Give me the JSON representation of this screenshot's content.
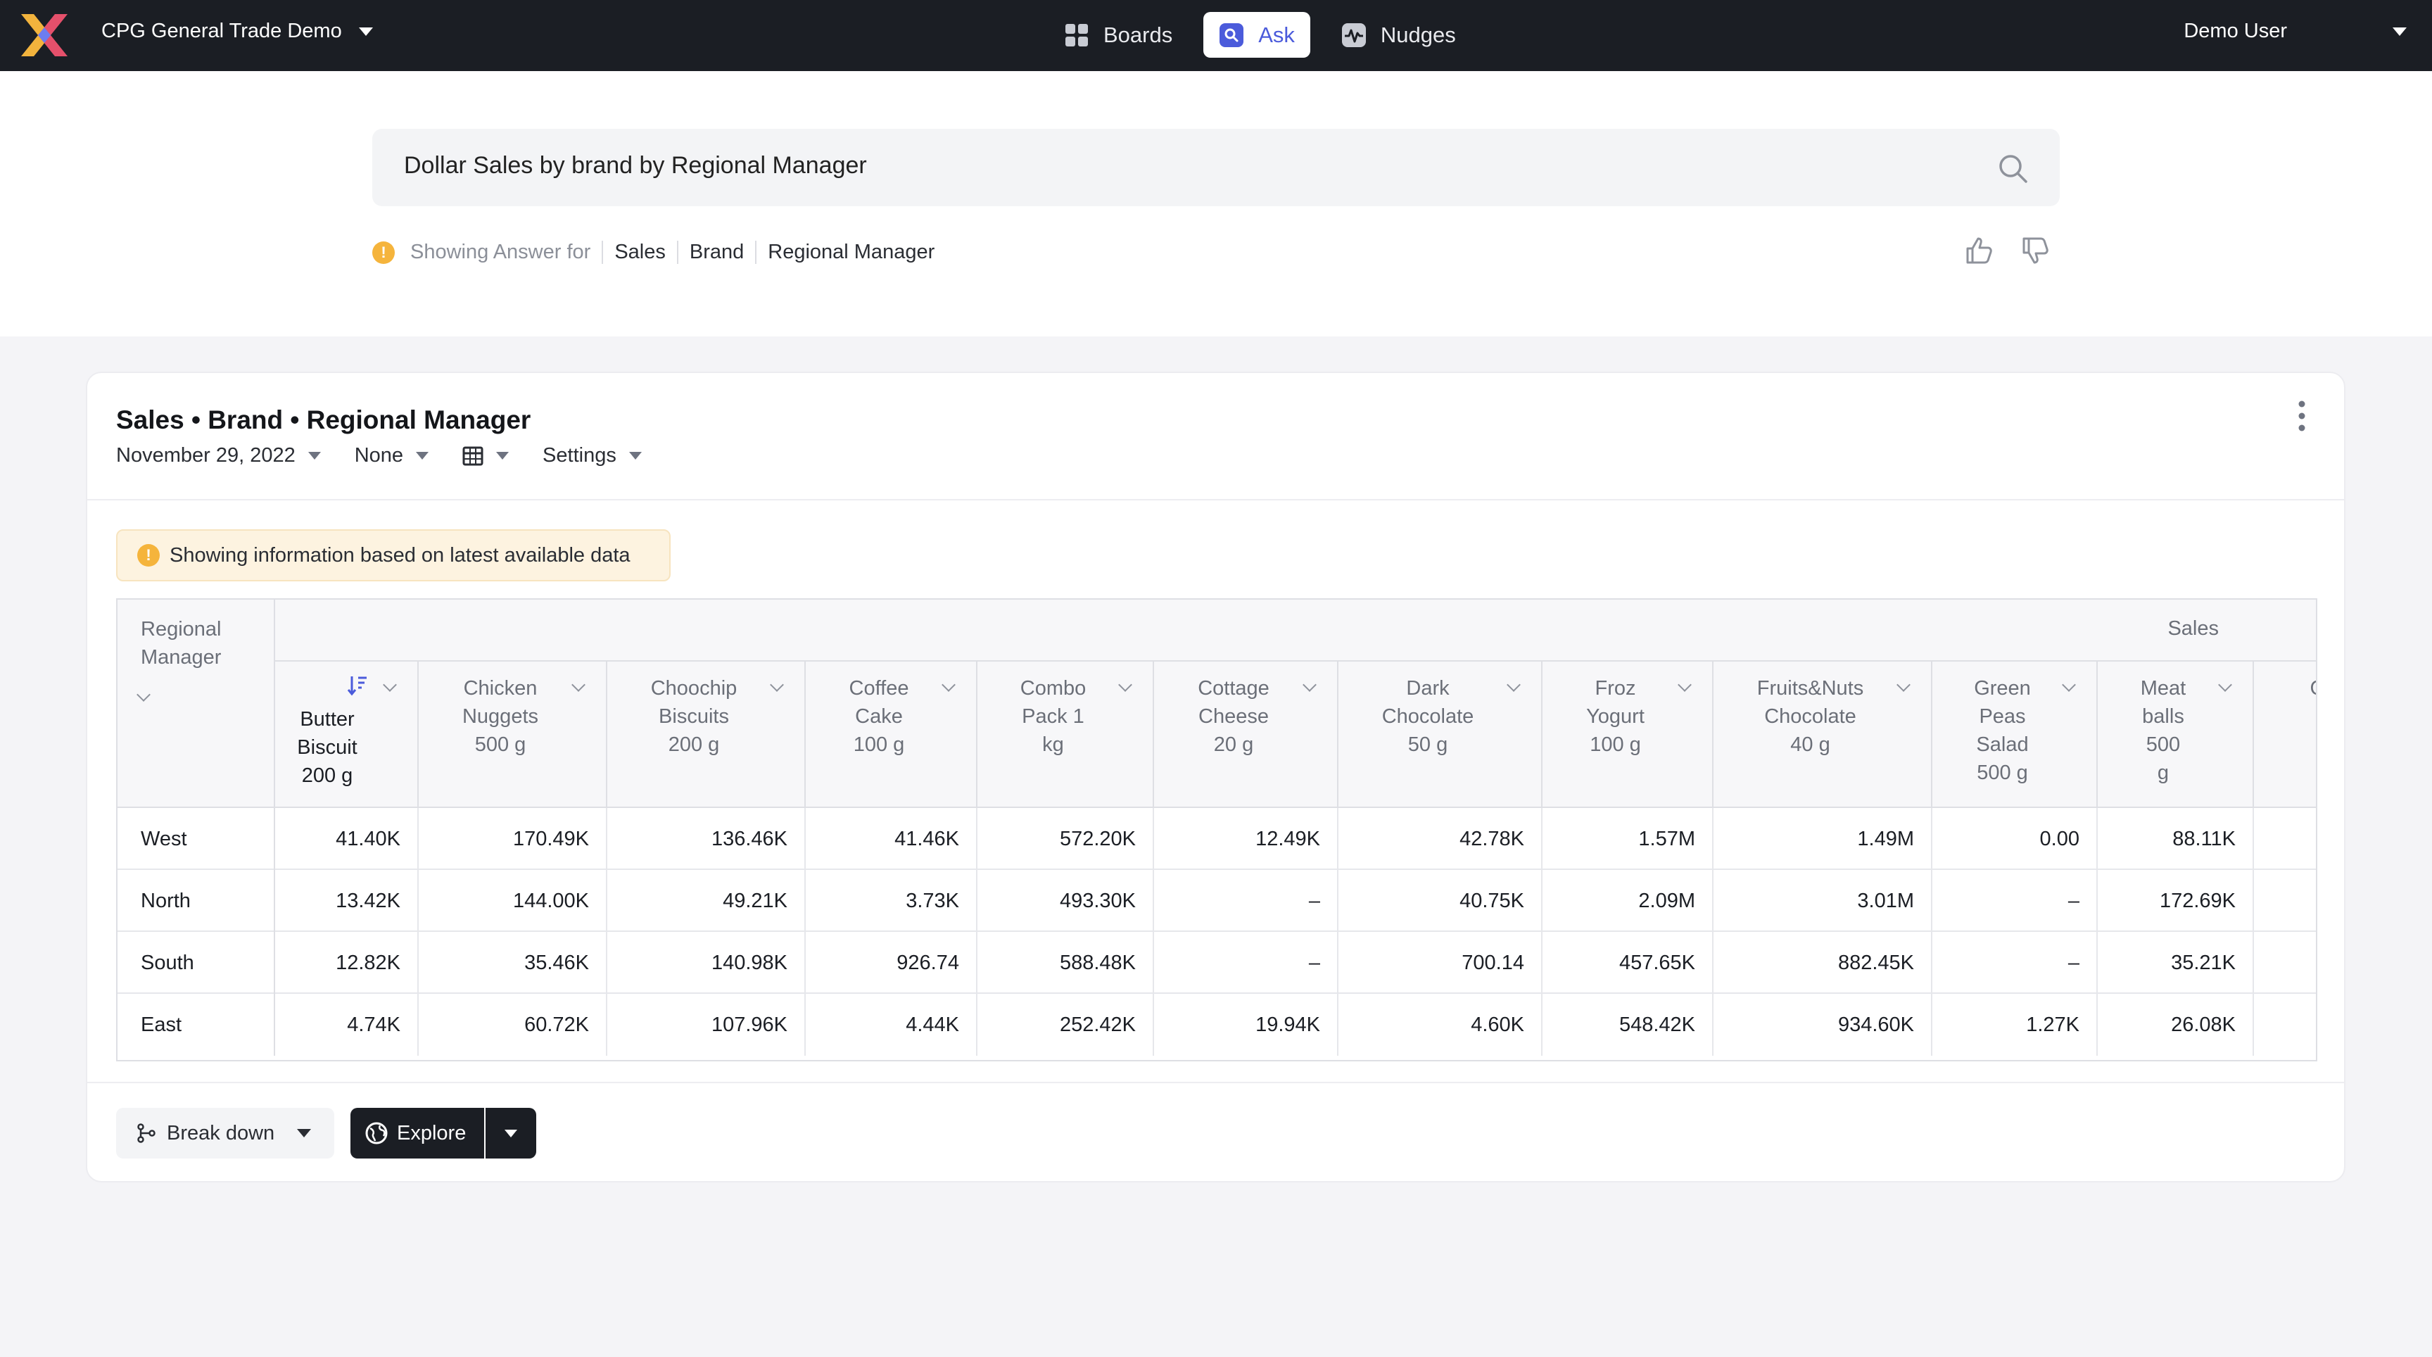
{
  "topbar": {
    "workspace": "CPG General Trade Demo",
    "nav": [
      {
        "label": "Boards",
        "icon": "boards-icon"
      },
      {
        "label": "Ask",
        "icon": "ask-icon",
        "active": true
      },
      {
        "label": "Nudges",
        "icon": "nudges-icon"
      }
    ],
    "user": "Demo User"
  },
  "search": {
    "query": "Dollar Sales by brand by Regional Manager",
    "answer_prefix": "Showing Answer for",
    "chips": [
      "Sales",
      "Brand",
      "Regional Manager"
    ]
  },
  "card": {
    "title": "Sales • Brand • Regional Manager",
    "date": "November 29, 2022",
    "compare": "None",
    "settings": "Settings",
    "banner": "Showing information based on latest available data",
    "table": {
      "row_header": "Regional Manager",
      "group_header": "Sales",
      "columns": [
        "Butter Biscuit 200 g",
        "Chicken Nuggets 500 g",
        "Choochip Biscuits 200 g",
        "Coffee Cake 100 g",
        "Combo Pack 1 kg",
        "Cottage Cheese 20 g",
        "Dark Chocolate 50 g",
        "Froz Yogurt 100 g",
        "Fruits&Nuts Chocolate 40 g",
        "Green Peas Salad 500 g",
        "Meat balls 500 g",
        "C"
      ],
      "column_lines": [
        [
          "Butter",
          "Biscuit",
          "200 g"
        ],
        [
          "Chicken",
          "Nuggets",
          "500 g"
        ],
        [
          "Choochip",
          "Biscuits",
          "200 g"
        ],
        [
          "Coffee",
          "Cake",
          "100 g"
        ],
        [
          "Combo",
          "Pack 1",
          "kg"
        ],
        [
          "Cottage",
          "Cheese",
          "20 g"
        ],
        [
          "Dark",
          "Chocolate",
          "50 g"
        ],
        [
          "Froz",
          "Yogurt",
          "100 g"
        ],
        [
          "Fruits&Nuts",
          "Chocolate",
          "40 g"
        ],
        [
          "Green",
          "Peas",
          "Salad",
          "500 g"
        ],
        [
          "Meat",
          "balls",
          "500",
          "g"
        ],
        [
          "C"
        ]
      ],
      "rows": [
        {
          "name": "West",
          "values": [
            "41.40K",
            "170.49K",
            "136.46K",
            "41.46K",
            "572.20K",
            "12.49K",
            "42.78K",
            "1.57M",
            "1.49M",
            "0.00",
            "88.11K",
            ""
          ]
        },
        {
          "name": "North",
          "values": [
            "13.42K",
            "144.00K",
            "49.21K",
            "3.73K",
            "493.30K",
            "–",
            "40.75K",
            "2.09M",
            "3.01M",
            "–",
            "172.69K",
            ""
          ]
        },
        {
          "name": "South",
          "values": [
            "12.82K",
            "35.46K",
            "140.98K",
            "926.74",
            "588.48K",
            "–",
            "700.14",
            "457.65K",
            "882.45K",
            "–",
            "35.21K",
            ""
          ]
        },
        {
          "name": "East",
          "values": [
            "4.74K",
            "60.72K",
            "107.96K",
            "4.44K",
            "252.42K",
            "19.94K",
            "4.60K",
            "548.42K",
            "934.60K",
            "1.27K",
            "26.08K",
            ""
          ]
        }
      ]
    },
    "actions": {
      "breakdown": "Break down",
      "explore": "Explore"
    }
  },
  "colors": {
    "topbar": "#1b1e24",
    "accent": "#4b5bdb",
    "warning": "#f5b43c",
    "banner_bg": "#fdf3e0"
  }
}
